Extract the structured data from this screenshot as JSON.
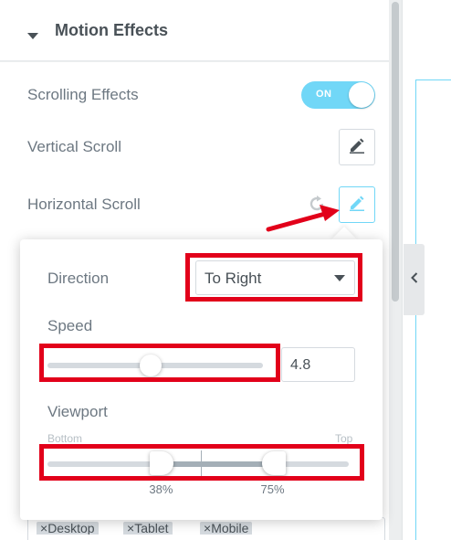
{
  "section": {
    "title": "Motion Effects"
  },
  "controls": {
    "scrolling_effects": {
      "label": "Scrolling Effects",
      "toggle_text": "ON",
      "enabled": true
    },
    "vertical_scroll": {
      "label": "Vertical Scroll"
    },
    "horizontal_scroll": {
      "label": "Horizontal Scroll"
    }
  },
  "popover": {
    "direction": {
      "label": "Direction",
      "value": "To Right",
      "options_visible": [
        "To Right"
      ]
    },
    "speed": {
      "label": "Speed",
      "value": "4.8",
      "slider_fraction": 0.48
    },
    "viewport": {
      "label": "Viewport",
      "bottom_label": "Bottom",
      "top_label": "Top",
      "start_label": "38%",
      "end_label": "75%",
      "start": 38,
      "end": 75
    }
  },
  "devices": {
    "tags": [
      {
        "remove": "×",
        "label": "Desktop"
      },
      {
        "remove": "×",
        "label": "Tablet"
      },
      {
        "remove": "×",
        "label": "Mobile"
      }
    ]
  },
  "icons": {
    "caret": "caret-down-icon",
    "edit": "pencil-icon",
    "reset": "reset-icon",
    "collapse": "chevron-left-icon"
  },
  "colors": {
    "accent": "#71d7f7",
    "highlight": "#e2001a",
    "text": "#6d7882",
    "heading": "#495157"
  }
}
